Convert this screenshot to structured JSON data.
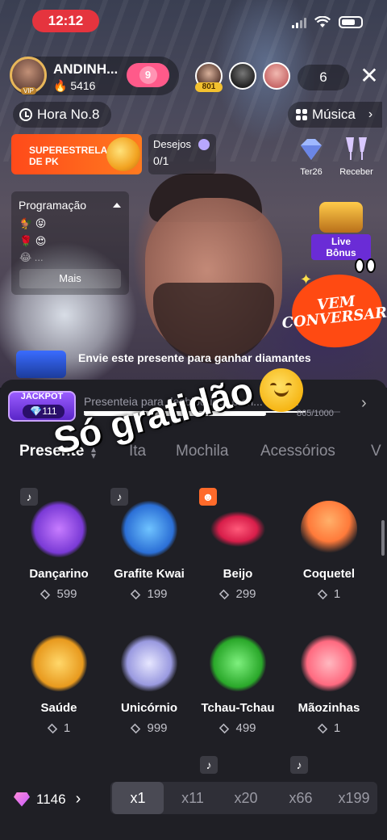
{
  "status_bar": {
    "time": "12:12"
  },
  "host": {
    "name": "ANDINH...",
    "likes": "5416",
    "vip_badge": "VIP",
    "follow_badge": "9"
  },
  "viewers": {
    "top_badge": "801",
    "count": "6"
  },
  "hour_pill": {
    "label": "Hora No.8"
  },
  "music_pill": {
    "label": "Música"
  },
  "pk_banner": {
    "label": "SUPERESTRELA DE PK"
  },
  "wishes": {
    "label": "Desejos",
    "value": "0/1"
  },
  "side_icons": [
    {
      "label": "Ter26"
    },
    {
      "label": "Receber"
    }
  ],
  "programacao": {
    "title": "Programação",
    "more": "Mais",
    "rows": [
      "🐓 😝",
      "🌹 😍",
      "😂 ..."
    ]
  },
  "live_bonus": {
    "label": "Live Bônus"
  },
  "sticker": {
    "line1": "VEM",
    "line2": "CONVERSAR!"
  },
  "promo": {
    "text": "Envie este presente para ganhar diamantes"
  },
  "overlay": {
    "text": "Só gratidão"
  },
  "jackpot": {
    "title": "JACKPOT",
    "value": "111",
    "description": "Presenteia para desbloquear o ch... multi...",
    "progress": "865/1000",
    "progress_fraction": 0.865
  },
  "tabs": [
    {
      "label": "Presente",
      "active": true
    },
    {
      "label": "Ita",
      "active": false
    },
    {
      "label": "Mochila",
      "active": false
    },
    {
      "label": "Acessórios",
      "active": false
    },
    {
      "label": "V",
      "active": false
    }
  ],
  "gifts": [
    {
      "name": "Dançarino",
      "price": "599",
      "icon": "dancer-icon",
      "color": "#c77cff"
    },
    {
      "name": "Grafite Kwai",
      "price": "199",
      "icon": "graffiti-icon",
      "color": "#4aa8ff"
    },
    {
      "name": "Beijo",
      "price": "299",
      "icon": "lips-icon",
      "color": "#ff3a6a"
    },
    {
      "name": "Coquetel",
      "price": "1",
      "icon": "cocktail-icon",
      "color": "#ff8a3a"
    },
    {
      "name": "Saúde",
      "price": "1",
      "icon": "beer-icon",
      "color": "#ffb23a"
    },
    {
      "name": "Unicórnio",
      "price": "999",
      "icon": "unicorn-icon",
      "color": "#b7b7ff"
    },
    {
      "name": "Tchau-Tchau",
      "price": "499",
      "icon": "alien-bye-icon",
      "color": "#4ad04a"
    },
    {
      "name": "Mãozinhas",
      "price": "1",
      "icon": "heart-hands-icon",
      "color": "#ff7a8a"
    }
  ],
  "balance": {
    "value": "1146"
  },
  "multipliers": [
    {
      "label": "x1",
      "active": true
    },
    {
      "label": "x11",
      "active": false
    },
    {
      "label": "x20",
      "active": false
    },
    {
      "label": "x66",
      "active": false
    },
    {
      "label": "x199",
      "active": false
    }
  ]
}
